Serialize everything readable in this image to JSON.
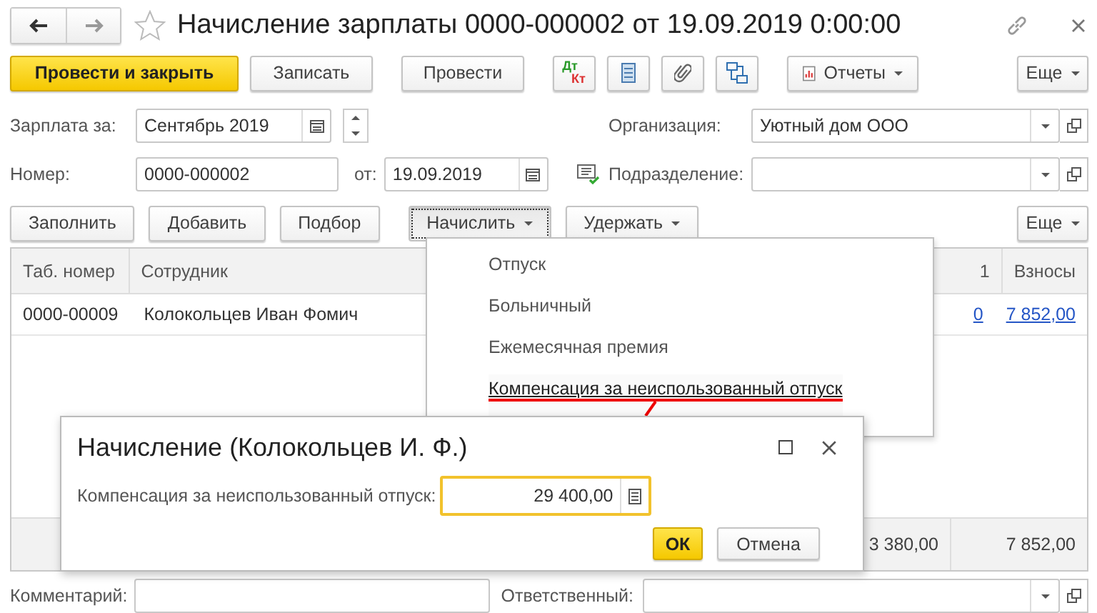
{
  "window": {
    "title": "Начисление зарплаты 0000-000002 от 19.09.2019 0:00:00"
  },
  "toolbar": {
    "post_close": "Провести и закрыть",
    "save": "Записать",
    "post": "Провести",
    "dtkt": {
      "debit": "Дт",
      "credit": "Кт"
    },
    "reports": "Отчеты",
    "more": "Еще"
  },
  "salary_for": {
    "label": "Зарплата за:",
    "value": "Сентябрь 2019"
  },
  "organization": {
    "label": "Организация:",
    "value": "Уютный дом ООО"
  },
  "number": {
    "label": "Номер:",
    "value": "0000-000002"
  },
  "date": {
    "label": "от:",
    "value": "19.09.2019"
  },
  "department": {
    "label": "Подразделение:"
  },
  "table_toolbar": [
    {
      "label": "Заполнить",
      "kind": "plain",
      "pressed": false
    },
    {
      "label": "Добавить",
      "kind": "plain",
      "pressed": false
    },
    {
      "label": "Подбор",
      "kind": "plain",
      "pressed": false
    },
    {
      "label": "Начислить",
      "kind": "menu",
      "pressed": true
    },
    {
      "label": "Удержать",
      "kind": "menu",
      "pressed": false
    }
  ],
  "table_more": "Еще",
  "table": {
    "columns": [
      "Таб. номер",
      "Сотрудник",
      "1",
      "Взносы"
    ],
    "rows": [
      {
        "cells": [
          "0000-00009",
          "Колокольцев Иван Фомич",
          "0",
          "7 852,00"
        ]
      }
    ],
    "totals": [
      "3 380,00",
      "7 852,00"
    ]
  },
  "accrue_menu": {
    "items": [
      {
        "label": "Отпуск",
        "selected": false
      },
      {
        "label": "Больничный",
        "selected": false
      },
      {
        "label": "Ежемесячная премия",
        "selected": false
      },
      {
        "label": "Компенсация за неиспользованный отпуск",
        "selected": true
      }
    ]
  },
  "dialog": {
    "title": "Начисление (Колокольцев И. Ф.)",
    "field_label": "Компенсация за неиспользованный отпуск:",
    "field_value": "29 400,00",
    "focused": true,
    "ok": "ОК",
    "cancel": "Отмена"
  },
  "comment": {
    "label": "Комментарий:"
  },
  "responsible": {
    "label": "Ответственный:"
  }
}
